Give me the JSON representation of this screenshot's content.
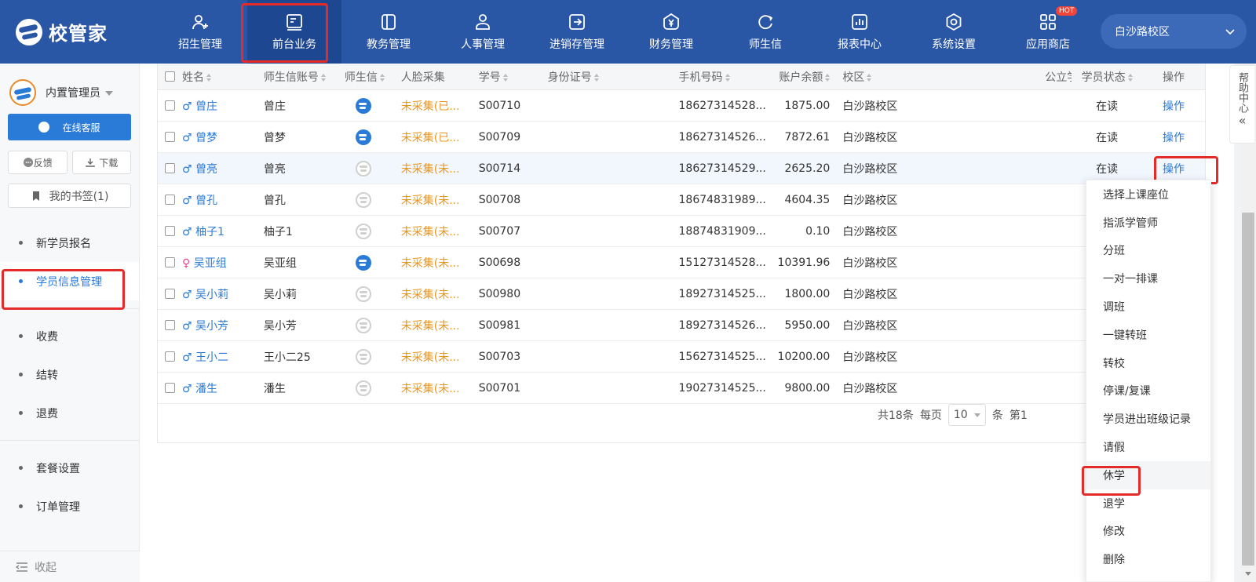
{
  "brand": {
    "name": "校管家"
  },
  "nav": [
    {
      "label": "招生管理",
      "icon": "user-plus-icon"
    },
    {
      "label": "前台业务",
      "icon": "reception-icon"
    },
    {
      "label": "教务管理",
      "icon": "book-icon"
    },
    {
      "label": "人事管理",
      "icon": "person-icon"
    },
    {
      "label": "进销存管理",
      "icon": "inventory-icon"
    },
    {
      "label": "财务管理",
      "icon": "yen-shield-icon"
    },
    {
      "label": "师生信",
      "icon": "chat-icon"
    },
    {
      "label": "报表中心",
      "icon": "report-icon"
    },
    {
      "label": "系统设置",
      "icon": "settings-icon"
    },
    {
      "label": "应用商店",
      "icon": "apps-icon",
      "badge": "HOT"
    }
  ],
  "campus": {
    "label": "白沙路校区"
  },
  "sidebar": {
    "user_name": "内置管理员",
    "service_label": "在线客服",
    "feedback_label": "反馈",
    "download_label": "下载",
    "bookmark_label": "我的书签(1)",
    "menu_group1": [
      "新学员报名",
      "学员信息管理"
    ],
    "menu_group2": [
      "收费",
      "结转",
      "退费"
    ],
    "menu_group3": [
      "套餐设置",
      "订单管理"
    ],
    "collapse_label": "收起"
  },
  "table": {
    "headers": [
      "姓名",
      "师生信账号",
      "师生信",
      "人脸采集",
      "学号",
      "身份证号",
      "手机号码",
      "账户余额",
      "校区",
      "公立学校",
      "学员状态",
      "操作"
    ],
    "rows": [
      {
        "gender": "♂",
        "name": "曾庄",
        "account": "曾庄",
        "wx_bound": true,
        "face": "未采集(已...",
        "no": "S00710",
        "phone": "18627314528...",
        "balance": "1875.00",
        "campus": "白沙路校区",
        "status": "在读",
        "op": "操作"
      },
      {
        "gender": "♂",
        "name": "曾梦",
        "account": "曾梦",
        "wx_bound": true,
        "face": "未采集(已...",
        "no": "S00709",
        "phone": "18627314526...",
        "balance": "7872.61",
        "campus": "白沙路校区",
        "status": "在读",
        "op": "操作"
      },
      {
        "gender": "♂",
        "name": "曾亮",
        "account": "曾亮",
        "wx_bound": false,
        "face": "未采集(未...",
        "no": "S00714",
        "phone": "18627314529...",
        "balance": "2625.20",
        "campus": "白沙路校区",
        "status": "在读",
        "op": "操作"
      },
      {
        "gender": "♂",
        "name": "曾孔",
        "account": "曾孔",
        "wx_bound": false,
        "face": "未采集(未...",
        "no": "S00708",
        "phone": "18674831989...",
        "balance": "4604.35",
        "campus": "白沙路校区",
        "status": "",
        "op": ""
      },
      {
        "gender": "♂",
        "name": "柚子1",
        "account": "柚子1",
        "wx_bound": false,
        "face": "未采集(未...",
        "no": "S00707",
        "phone": "18874831909...",
        "balance": "0.10",
        "campus": "白沙路校区",
        "status": "",
        "op": ""
      },
      {
        "gender": "♀",
        "name": "吴亚组",
        "account": "吴亚组",
        "wx_bound": true,
        "face": "未采集(未...",
        "no": "S00698",
        "phone": "15127314528...",
        "balance": "10391.96",
        "campus": "白沙路校区",
        "status": "",
        "op": ""
      },
      {
        "gender": "♂",
        "name": "吴小莉",
        "account": "吴小莉",
        "wx_bound": false,
        "face": "未采集(未...",
        "no": "S00980",
        "phone": "18927314525...",
        "balance": "1800.00",
        "campus": "白沙路校区",
        "status": "",
        "op": ""
      },
      {
        "gender": "♂",
        "name": "吴小芳",
        "account": "吴小芳",
        "wx_bound": false,
        "face": "未采集(未...",
        "no": "S00981",
        "phone": "18927314526...",
        "balance": "5950.00",
        "campus": "白沙路校区",
        "status": "",
        "op": ""
      },
      {
        "gender": "♂",
        "name": "王小二",
        "account": "王小二25",
        "wx_bound": false,
        "face": "未采集(未...",
        "no": "S00703",
        "phone": "15627314525...",
        "balance": "10200.00",
        "campus": "白沙路校区",
        "status": "",
        "op": ""
      },
      {
        "gender": "♂",
        "name": "潘生",
        "account": "潘生",
        "wx_bound": false,
        "face": "未采集(未...",
        "no": "S00701",
        "phone": "19027314525...",
        "balance": "9800.00",
        "campus": "白沙路校区",
        "status": "",
        "op": ""
      }
    ]
  },
  "pager": {
    "total": "共18条",
    "per_page_label": "每页",
    "per_page": "10",
    "unit": "条",
    "page_prefix": "第1"
  },
  "dropdown": [
    "选择上课座位",
    "指派学管师",
    "分班",
    "一对一排课",
    "调班",
    "一键转班",
    "转校",
    "停课/复课",
    "学员进出班级记录",
    "请假",
    "休学",
    "退学",
    "修改",
    "删除"
  ],
  "help": {
    "label": "帮助中心",
    "arrow": "«"
  },
  "colors": {
    "primary": "#2a56a6",
    "accent": "#2a7ad8",
    "highlight": "#e52a2a",
    "face_text": "#e8961e"
  }
}
